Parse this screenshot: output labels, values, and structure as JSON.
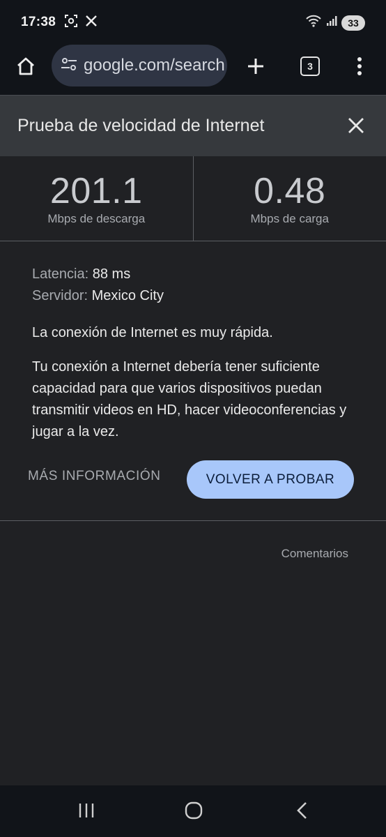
{
  "status_bar": {
    "time": "17:38",
    "battery": "33",
    "icons": [
      "screenshot-icon",
      "x-logo-icon",
      "wifi-icon",
      "signal-icon"
    ]
  },
  "toolbar": {
    "url": "google.com/search",
    "tab_count": "3",
    "icons": [
      "home-icon",
      "site-settings-icon",
      "plus-icon",
      "more-vert-icon"
    ]
  },
  "panel": {
    "title": "Prueba de velocidad de Internet"
  },
  "results": {
    "download_value": "201.1",
    "download_label": "Mbps de descarga",
    "upload_value": "0.48",
    "upload_label": "Mbps de carga"
  },
  "details": {
    "latency_key": "Latencia:",
    "latency_value": "88 ms",
    "server_key": "Servidor:",
    "server_value": "Mexico City",
    "summary": "La conexión de Internet es muy rápida.",
    "description": "Tu conexión a Internet debería tener suficiente capacidad para que varios dispositivos puedan transmitir videos en HD, hacer videoconferencias y jugar a la vez."
  },
  "actions": {
    "more_info": "MÁS INFORMACIÓN",
    "retry": "VOLVER A PROBAR",
    "feedback": "Comentarios"
  },
  "colors": {
    "accent": "#a8c7fa",
    "background": "#202124",
    "header": "#36393d"
  }
}
